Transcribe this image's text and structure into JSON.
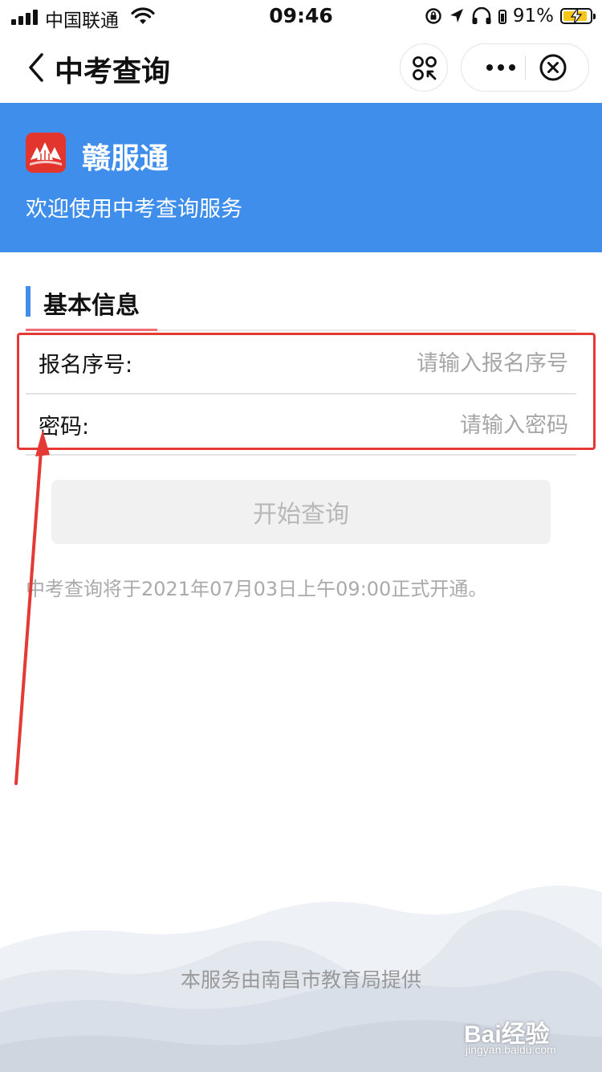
{
  "status_bar": {
    "carrier": "中国联通",
    "time": "09:46",
    "battery_percent": "91%",
    "battery_level": 0.91
  },
  "nav": {
    "title": "中考查询"
  },
  "banner": {
    "brand": "赣服通",
    "welcome": "欢迎使用中考查询服务",
    "color": "#3f8eec"
  },
  "section": {
    "title": "基本信息"
  },
  "form": {
    "reg_label": "报名序号:",
    "reg_placeholder": "请输入报名序号",
    "reg_value": "",
    "pwd_label": "密码:",
    "pwd_placeholder": "请输入密码",
    "pwd_value": ""
  },
  "query_button": "开始查询",
  "notice": "中考查询将于2021年07月03日上午09:00正式开通。",
  "footer": {
    "provider": "本服务由南昌市教育局提供"
  },
  "watermark": {
    "main": "Bai经验",
    "sub": "jingyan.baidu.com"
  },
  "colors": {
    "highlight": "#e53935",
    "section_bar": "#3f8eec",
    "section_underline": "#f06f76"
  }
}
